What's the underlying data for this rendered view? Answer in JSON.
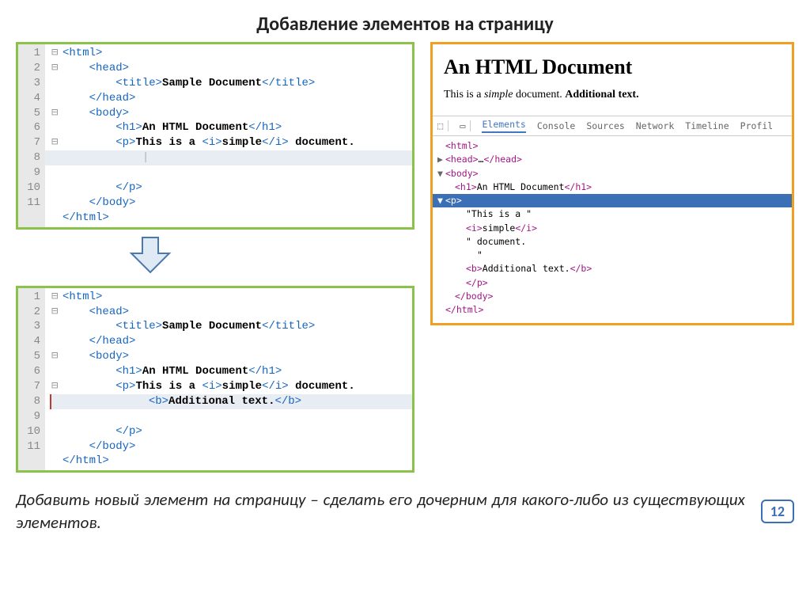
{
  "title": "Добавление элементов на страницу",
  "code_top": {
    "lines": 11,
    "rows": [
      {
        "n": 1,
        "fold": "⊟",
        "indent": 0,
        "tag_open": "<html>",
        "text": "",
        "tag_close": ""
      },
      {
        "n": 2,
        "fold": "⊟",
        "indent": 1,
        "tag_open": "<head>",
        "text": "",
        "tag_close": ""
      },
      {
        "n": 3,
        "fold": "",
        "indent": 2,
        "tag_open": "<title>",
        "text": "Sample Document",
        "tag_close": "</title>"
      },
      {
        "n": 4,
        "fold": "",
        "indent": 1,
        "tag_open": "</head>",
        "text": "",
        "tag_close": ""
      },
      {
        "n": 5,
        "fold": "⊟",
        "indent": 1,
        "tag_open": "<body>",
        "text": "",
        "tag_close": ""
      },
      {
        "n": 6,
        "fold": "",
        "indent": 2,
        "tag_open": "<h1>",
        "text": "An HTML Document",
        "tag_close": "</h1>"
      },
      {
        "n": 7,
        "fold": "⊟",
        "indent": 2,
        "tag_open": "<p>",
        "text": "",
        "tag_close": "",
        "multi": [
          {
            "t": "txt",
            "v": "This is a "
          },
          {
            "t": "tag",
            "v": "<i>"
          },
          {
            "t": "txt",
            "v": "simple"
          },
          {
            "t": "tag",
            "v": "</i>"
          },
          {
            "t": "txt",
            "v": " document."
          }
        ]
      },
      {
        "n": 8,
        "fold": "",
        "indent": 3,
        "cursor": true,
        "hl": true
      },
      {
        "n": 9,
        "fold": "",
        "indent": 2,
        "tag_open": "</p>",
        "text": "",
        "tag_close": ""
      },
      {
        "n": 10,
        "fold": "",
        "indent": 1,
        "tag_open": "</body>",
        "text": "",
        "tag_close": ""
      },
      {
        "n": 11,
        "fold": "",
        "indent": 0,
        "tag_open": "</html>",
        "text": "",
        "tag_close": ""
      }
    ]
  },
  "code_bottom": {
    "lines": 11,
    "rows": [
      {
        "n": 1,
        "fold": "⊟",
        "indent": 0,
        "tag_open": "<html>",
        "text": "",
        "tag_close": ""
      },
      {
        "n": 2,
        "fold": "⊟",
        "indent": 1,
        "tag_open": "<head>",
        "text": "",
        "tag_close": ""
      },
      {
        "n": 3,
        "fold": "",
        "indent": 2,
        "tag_open": "<title>",
        "text": "Sample Document",
        "tag_close": "</title>"
      },
      {
        "n": 4,
        "fold": "",
        "indent": 1,
        "tag_open": "</head>",
        "text": "",
        "tag_close": ""
      },
      {
        "n": 5,
        "fold": "⊟",
        "indent": 1,
        "tag_open": "<body>",
        "text": "",
        "tag_close": ""
      },
      {
        "n": 6,
        "fold": "",
        "indent": 2,
        "tag_open": "<h1>",
        "text": "An HTML Document",
        "tag_close": "</h1>"
      },
      {
        "n": 7,
        "fold": "⊟",
        "indent": 2,
        "tag_open": "<p>",
        "text": "",
        "tag_close": "",
        "multi": [
          {
            "t": "txt",
            "v": "This is a "
          },
          {
            "t": "tag",
            "v": "<i>"
          },
          {
            "t": "txt",
            "v": "simple"
          },
          {
            "t": "tag",
            "v": "</i>"
          },
          {
            "t": "txt",
            "v": " document."
          }
        ]
      },
      {
        "n": 8,
        "fold": "",
        "indent": 3,
        "hl": true,
        "red": true,
        "multi": [
          {
            "t": "tag",
            "v": "<b>"
          },
          {
            "t": "txt",
            "v": "Additional text."
          },
          {
            "t": "tag",
            "v": "</b>"
          }
        ]
      },
      {
        "n": 9,
        "fold": "",
        "indent": 2,
        "tag_open": "</p>",
        "text": "",
        "tag_close": ""
      },
      {
        "n": 10,
        "fold": "",
        "indent": 1,
        "tag_open": "</body>",
        "text": "",
        "tag_close": ""
      },
      {
        "n": 11,
        "fold": "",
        "indent": 0,
        "tag_open": "</html>",
        "text": "",
        "tag_close": ""
      }
    ]
  },
  "browser": {
    "heading": "An HTML Document",
    "p_parts": [
      "This is a ",
      "simple",
      " document. ",
      "Additional text."
    ]
  },
  "devtools": {
    "tabs": [
      "Elements",
      "Console",
      "Sources",
      "Network",
      "Timeline",
      "Profil"
    ],
    "active_tab": "Elements",
    "tree": [
      {
        "lvl": 0,
        "arrow": "",
        "content": [
          {
            "t": "t",
            "v": "<html>"
          }
        ]
      },
      {
        "lvl": 0,
        "arrow": "▶",
        "content": [
          {
            "t": "t",
            "v": "<head>"
          },
          {
            "t": "p",
            "v": "…"
          },
          {
            "t": "t",
            "v": "</head>"
          }
        ]
      },
      {
        "lvl": 0,
        "arrow": "▼",
        "content": [
          {
            "t": "t",
            "v": "<body>"
          }
        ]
      },
      {
        "lvl": 1,
        "arrow": "",
        "content": [
          {
            "t": "t",
            "v": "<h1>"
          },
          {
            "t": "p",
            "v": "An HTML Document"
          },
          {
            "t": "t",
            "v": "</h1>"
          }
        ]
      },
      {
        "lvl": 1,
        "arrow": "▼",
        "sel": true,
        "content": [
          {
            "t": "t",
            "v": "<p>"
          }
        ]
      },
      {
        "lvl": 2,
        "arrow": "",
        "content": [
          {
            "t": "p",
            "v": "\"This is a \""
          }
        ]
      },
      {
        "lvl": 2,
        "arrow": "",
        "content": [
          {
            "t": "t",
            "v": "<i>"
          },
          {
            "t": "p",
            "v": "simple"
          },
          {
            "t": "t",
            "v": "</i>"
          }
        ]
      },
      {
        "lvl": 2,
        "arrow": "",
        "content": [
          {
            "t": "p",
            "v": "\" document."
          }
        ]
      },
      {
        "lvl": 3,
        "arrow": "",
        "content": [
          {
            "t": "p",
            "v": "\""
          }
        ]
      },
      {
        "lvl": 2,
        "arrow": "",
        "content": [
          {
            "t": "t",
            "v": "<b>"
          },
          {
            "t": "p",
            "v": "Additional text."
          },
          {
            "t": "t",
            "v": "</b>"
          }
        ]
      },
      {
        "lvl": 2,
        "arrow": "",
        "content": [
          {
            "t": "t",
            "v": "</p>"
          }
        ]
      },
      {
        "lvl": 1,
        "arrow": "",
        "content": [
          {
            "t": "t",
            "v": "</body>"
          }
        ]
      },
      {
        "lvl": 0,
        "arrow": "",
        "content": [
          {
            "t": "t",
            "v": "</html>"
          }
        ]
      }
    ]
  },
  "footer": "Добавить новый элемент на страницу – сделать его дочерним для какого-либо из существующих элементов.",
  "page_number": "12"
}
